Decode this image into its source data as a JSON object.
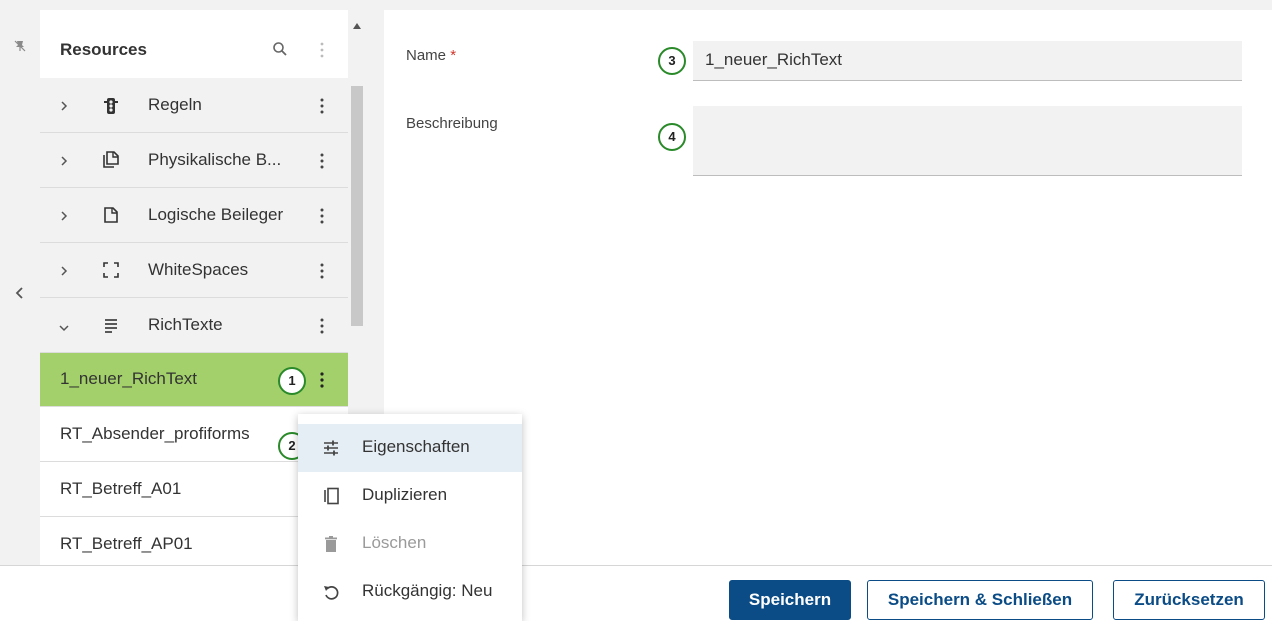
{
  "tree": {
    "title": "Resources",
    "groups": [
      {
        "label": "Regeln",
        "icon": "traffic-light-icon",
        "expanded": false
      },
      {
        "label": "Physikalische B...",
        "icon": "pages-icon",
        "expanded": false
      },
      {
        "label": "Logische Beileger",
        "icon": "document-icon",
        "expanded": false
      },
      {
        "label": "WhiteSpaces",
        "icon": "frame-corners-icon",
        "expanded": false
      },
      {
        "label": "RichTexte",
        "icon": "text-lines-icon",
        "expanded": true
      }
    ],
    "items": [
      {
        "label": "1_neuer_RichText",
        "selected": true
      },
      {
        "label": "RT_Absender_profiforms",
        "selected": false
      },
      {
        "label": "RT_Betreff_A01",
        "selected": false
      },
      {
        "label": "RT_Betreff_AP01",
        "selected": false
      }
    ]
  },
  "context_menu": {
    "items": [
      {
        "label": "Eigenschaften",
        "icon": "tune-sliders-icon",
        "active": true,
        "disabled": false
      },
      {
        "label": "Duplizieren",
        "icon": "copy-icon",
        "active": false,
        "disabled": false
      },
      {
        "label": "Löschen",
        "icon": "trash-icon",
        "active": false,
        "disabled": true
      },
      {
        "label": "Rückgängig: Neu",
        "icon": "undo-icon",
        "active": false,
        "disabled": false
      }
    ]
  },
  "form": {
    "name_label": "Name",
    "required_mark": "*",
    "name_value": "1_neuer_RichText",
    "description_label": "Beschreibung",
    "description_value": ""
  },
  "callouts": [
    "1",
    "2",
    "3",
    "4"
  ],
  "footer": {
    "save": "Speichern",
    "save_close": "Speichern & Schließen",
    "reset": "Zurücksetzen"
  },
  "colors": {
    "accent": "#0b4c86",
    "selected_row": "#a3d06a",
    "callout_ring": "#2a8a2a",
    "required": "#d0352b",
    "panel_bg": "#f2f2f2"
  }
}
